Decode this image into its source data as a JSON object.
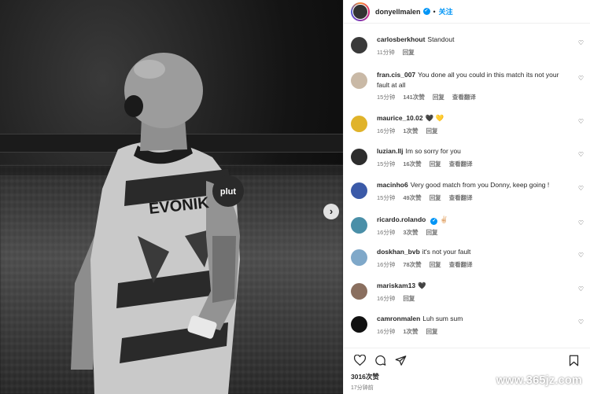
{
  "post": {
    "owner": "donyellmalen",
    "follow_label": "关注",
    "separator": "•",
    "likes": "3016次赞",
    "time": "17分钟前"
  },
  "comments": [
    {
      "user": "carlosberkhout",
      "text": "Standout",
      "time": "11分钟",
      "likes": "",
      "reply": "回复",
      "translate": "",
      "avatar_color": "#3a3a3a"
    },
    {
      "user": "fran.cis_007",
      "text": "You done all you could in this match its not your fault at all",
      "time": "15分钟",
      "likes": "141次赞",
      "reply": "回复",
      "translate": "查看翻译",
      "avatar_color": "#c9b9a6"
    },
    {
      "user": "maurice_10.02",
      "text": "🖤 💛",
      "time": "16分钟",
      "likes": "1次赞",
      "reply": "回复",
      "translate": "",
      "avatar_color": "#e0b32a"
    },
    {
      "user": "luzian.llj",
      "text": "Im so sorry for you",
      "time": "15分钟",
      "likes": "16次赞",
      "reply": "回复",
      "translate": "查看翻译",
      "avatar_color": "#2d2d2d"
    },
    {
      "user": "macinho6",
      "text": "Very good match from you Donny, keep going !",
      "time": "15分钟",
      "likes": "49次赞",
      "reply": "回复",
      "translate": "查看翻译",
      "avatar_color": "#3b5aa8"
    },
    {
      "user": "ricardo.rolando",
      "text": "✌🏻",
      "time": "16分钟",
      "likes": "3次赞",
      "reply": "回复",
      "translate": "",
      "avatar_color": "#4a8fa8",
      "verified": true
    },
    {
      "user": "doskhan_bvb",
      "text": "it's not your fault",
      "time": "16分钟",
      "likes": "78次赞",
      "reply": "回复",
      "translate": "查看翻译",
      "avatar_color": "#7fa8c9"
    },
    {
      "user": "mariskam13",
      "text": "🖤",
      "time": "16分钟",
      "likes": "",
      "reply": "回复",
      "translate": "",
      "avatar_color": "#8a6f5f"
    },
    {
      "user": "camronmalen",
      "text": "Luh sum sum",
      "time": "16分钟",
      "likes": "1次赞",
      "reply": "回复",
      "translate": "",
      "avatar_color": "#111111"
    }
  ],
  "icons": {
    "like": "heart-outline-icon",
    "comment": "speech-bubble-icon",
    "share": "paper-plane-icon",
    "save": "bookmark-icon",
    "next": "chevron-right-icon",
    "verified": "verified-badge-icon"
  },
  "colors": {
    "accent": "#0095f6",
    "text": "#262626",
    "muted": "#737373"
  },
  "watermark": "www.365jz.com"
}
